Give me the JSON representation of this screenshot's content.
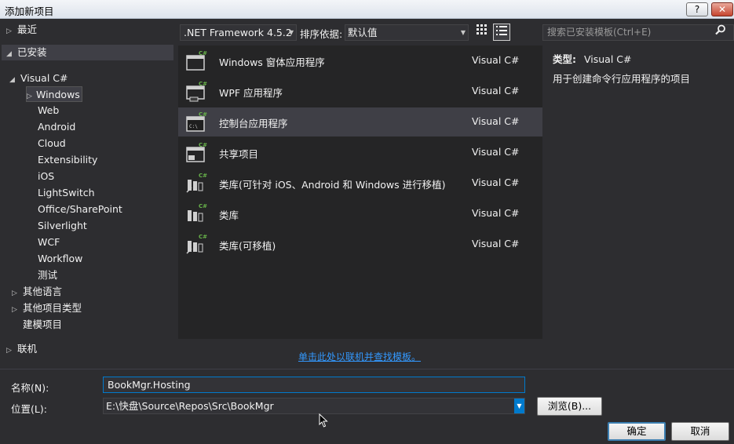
{
  "window": {
    "title": "添加新项目",
    "help_label": "?",
    "close_label": "✕"
  },
  "sidebar": {
    "recent": "最近",
    "installed": "已安装",
    "visual_csharp": "Visual C#",
    "items": [
      "Windows",
      "Web",
      "Android",
      "Cloud",
      "Extensibility",
      "iOS",
      "LightSwitch",
      "Office/SharePoint",
      "Silverlight",
      "WCF",
      "Workflow",
      "测试"
    ],
    "other_languages": "其他语言",
    "other_project_types": "其他项目类型",
    "modeling_projects": "建模项目",
    "online": "联机"
  },
  "toolbar": {
    "framework": ".NET Framework 4.5.2",
    "sort_label": "排序依据:",
    "sort_value": "默认值"
  },
  "templates": [
    {
      "name": "Windows 窗体应用程序",
      "lang": "Visual C#",
      "icon": "winforms-icon"
    },
    {
      "name": "WPF 应用程序",
      "lang": "Visual C#",
      "icon": "wpf-icon"
    },
    {
      "name": "控制台应用程序",
      "lang": "Visual C#",
      "icon": "console-icon"
    },
    {
      "name": "共享项目",
      "lang": "Visual C#",
      "icon": "shared-project-icon"
    },
    {
      "name": "类库(可针对 iOS、Android 和 Windows 进行移植)",
      "lang": "Visual C#",
      "icon": "portable-library-icon"
    },
    {
      "name": "类库",
      "lang": "Visual C#",
      "icon": "class-library-icon"
    },
    {
      "name": "类库(可移植)",
      "lang": "Visual C#",
      "icon": "portable-class-library-icon"
    }
  ],
  "selected_template_index": 2,
  "online_link": "单击此处以联机并查找模板。",
  "details": {
    "search_placeholder": "搜索已安装模板(Ctrl+E)",
    "type_key": "类型:",
    "type_value": "Visual C#",
    "description": "用于创建命令行应用程序的项目"
  },
  "form": {
    "name_label": "名称(N):",
    "name_value": "BookMgr.Hosting",
    "location_label": "位置(L):",
    "location_value": "E:\\快盘\\Source\\Repos\\Src\\BookMgr",
    "browse_label": "浏览(B)...",
    "ok_label": "确定",
    "cancel_label": "取消"
  },
  "colors": {
    "background": "#2d2d30",
    "list_background": "#252526",
    "selection": "#3f3f46",
    "accent": "#007acc",
    "link": "#3399ff",
    "csharp_badge": "#68b44a"
  }
}
